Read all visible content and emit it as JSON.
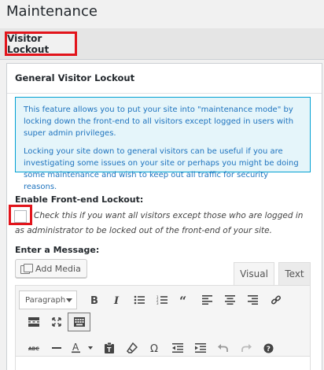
{
  "page": {
    "title": "Maintenance"
  },
  "tabs": [
    {
      "label": "Visitor Lockout",
      "active": true
    }
  ],
  "panel": {
    "title": "General Visitor Lockout",
    "notice": {
      "p1": "This feature allows you to put your site into \"maintenance mode\" by locking down the front-end to all visitors except logged in users with super admin privileges.",
      "p2": "Locking your site down to general visitors can be useful if you are investigating some issues on your site or perhaps you might be doing some maintenance and wish to keep out all traffic for security reasons."
    },
    "lockout": {
      "label": "Enable Front-end Lockout:",
      "checked": false,
      "description": "Check this if you want all visitors except those who are logged in as administrator to be locked out of the front-end of your site."
    },
    "message": {
      "label": "Enter a Message:",
      "add_media_label": "Add Media",
      "tab_visual": "Visual",
      "tab_text": "Text",
      "format_value": "Paragraph"
    }
  },
  "icons": {
    "row1": [
      "bold-icon",
      "italic-icon",
      "bulleted-list-icon",
      "numbered-list-icon",
      "blockquote-icon",
      "align-left-icon",
      "align-center-icon",
      "align-right-icon",
      "link-icon"
    ],
    "row2": [
      "read-more-icon",
      "fullscreen-icon",
      "toolbar-toggle-icon"
    ],
    "row3": [
      "strikethrough-icon",
      "horizontal-line-icon",
      "text-color-icon",
      "paste-as-text-icon",
      "clear-formatting-icon",
      "special-character-icon",
      "outdent-icon",
      "indent-icon",
      "undo-icon",
      "redo-icon",
      "help-icon"
    ]
  },
  "colors": {
    "highlight_border": "#e2141b",
    "notice_border": "#00a0d2",
    "notice_text": "#1e73be"
  }
}
